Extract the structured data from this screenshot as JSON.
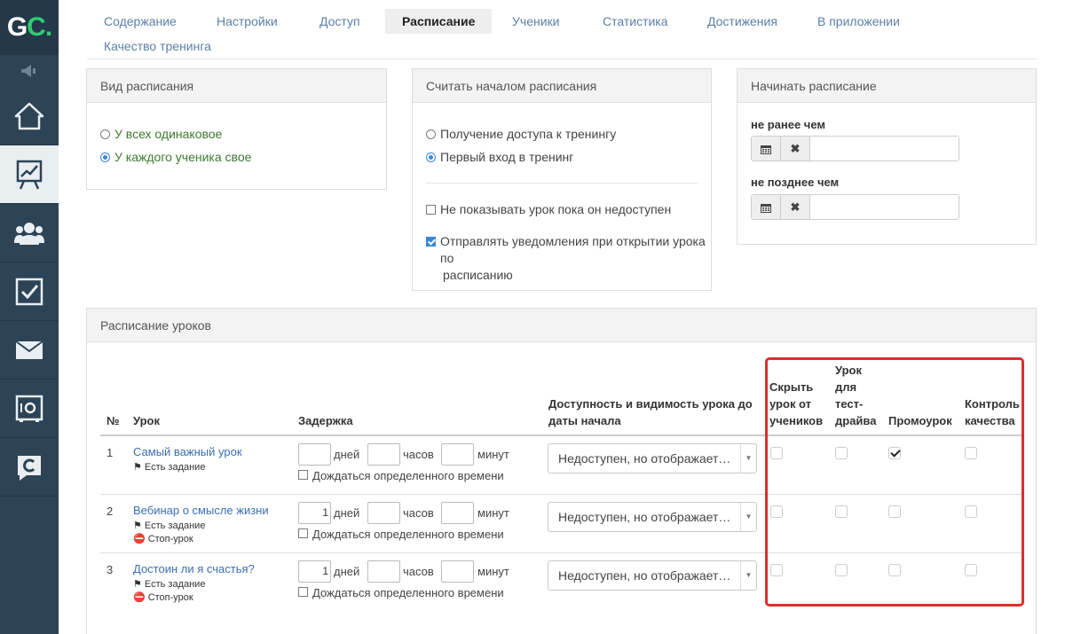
{
  "logo": {
    "g": "G",
    "c": "C",
    "dot": "."
  },
  "sidebar": {
    "icons": [
      "speaker-icon",
      "home-icon",
      "chart-icon",
      "users-icon",
      "checkbox-icon",
      "mail-icon",
      "safe-icon",
      "chat-icon"
    ]
  },
  "tabs": [
    "Содержание",
    "Настройки",
    "Доступ",
    "Расписание",
    "Ученики",
    "Статистика",
    "Достижения",
    "В приложении",
    "Качество тренинга"
  ],
  "active_tab": "Расписание",
  "view_panel": {
    "title": "Вид расписания",
    "options": [
      "У всех одинаковое",
      "У каждого ученика свое"
    ],
    "selected": "У каждого ученика свое"
  },
  "start_panel": {
    "title": "Считать началом расписания",
    "options": [
      "Получение доступа к тренингу",
      "Первый вход в тренинг"
    ],
    "selected": "Первый вход в тренинг",
    "check1": "Не показывать урок пока он недоступен",
    "check1_checked": false,
    "check2_line1": "Отправлять уведомления при открытии урока по",
    "check2_line2": "расписанию",
    "check2_checked": true
  },
  "begin_panel": {
    "title": "Начинать расписание",
    "not_before": "не ранее чем",
    "not_after": "не позднее чем",
    "not_before_value": "",
    "not_after_value": ""
  },
  "schedule": {
    "title": "Расписание уроков",
    "headers": {
      "num": "№",
      "lesson": "Урок",
      "delay": "Задержка",
      "avail_line1": "Доступность и видимость урока до",
      "avail_line2": "даты начала",
      "hide": [
        "Скрыть",
        "урок от",
        "учеников"
      ],
      "test": [
        "Урок",
        "для",
        "тест-",
        "драйва"
      ],
      "promo": "Промоурок",
      "quality": [
        "Контроль",
        "качества"
      ]
    },
    "units": {
      "days": "дней",
      "hours": "часов",
      "minutes": "минут"
    },
    "wait_label": "Дождаться определенного времени",
    "task_label": "Есть задание",
    "stop_label": "Стоп-урок",
    "rows": [
      {
        "num": "1",
        "title": "Самый важный урок",
        "days": "",
        "hours": "",
        "minutes": "",
        "has_task": true,
        "stop": false,
        "availability": "Недоступен, но отображает…",
        "hide": false,
        "test": false,
        "promo": true,
        "quality": false
      },
      {
        "num": "2",
        "title": "Вебинар о смысле жизни",
        "days": "1",
        "hours": "",
        "minutes": "",
        "has_task": true,
        "stop": true,
        "availability": "Недоступен, но отображает…",
        "hide": false,
        "test": false,
        "promo": false,
        "quality": false
      },
      {
        "num": "3",
        "title": "Достоин ли я счастья?",
        "days": "1",
        "hours": "",
        "minutes": "",
        "has_task": true,
        "stop": true,
        "availability": "Недоступен, но отображает…",
        "hide": false,
        "test": false,
        "promo": false,
        "quality": false
      }
    ]
  },
  "colors": {
    "sidebar": "#2d4356",
    "link": "#3a6fb0",
    "highlight": "#d9302c",
    "logo_accent": "#2ecc71"
  }
}
